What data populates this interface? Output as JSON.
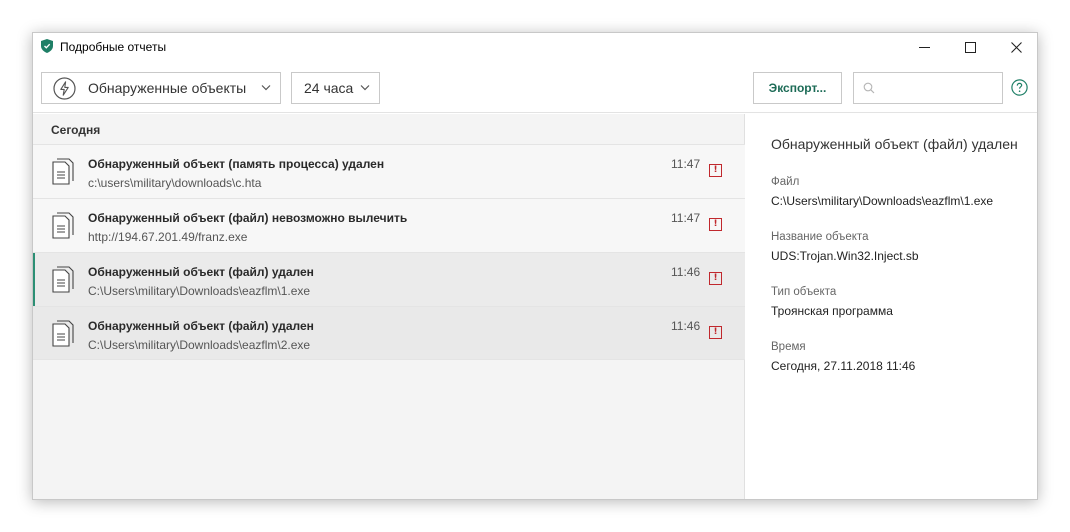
{
  "window": {
    "title": "Подробные отчеты"
  },
  "toolbar": {
    "type_filter": "Обнаруженные объекты",
    "period_filter": "24 часа",
    "export_label": "Экспорт...",
    "search_placeholder": ""
  },
  "list": {
    "group_label": "Сегодня",
    "rows": [
      {
        "title": "Обнаруженный объект (память процесса) удален",
        "path": "c:\\users\\military\\downloads\\c.hta",
        "time": "11:47",
        "badge": "!"
      },
      {
        "title": "Обнаруженный объект (файл) невозможно вылечить",
        "path": "http://194.67.201.49/franz.exe",
        "time": "11:47",
        "badge": "!"
      },
      {
        "title": "Обнаруженный объект (файл) удален",
        "path": "C:\\Users\\military\\Downloads\\eazflm\\1.exe",
        "time": "11:46",
        "badge": "!"
      },
      {
        "title": "Обнаруженный объект (файл) удален",
        "path": "C:\\Users\\military\\Downloads\\eazflm\\2.exe",
        "time": "11:46",
        "badge": "!"
      }
    ]
  },
  "details": {
    "title": "Обнаруженный объект (файл) удален",
    "fields": [
      {
        "label": "Файл",
        "value": "C:\\Users\\military\\Downloads\\eazflm\\1.exe"
      },
      {
        "label": "Название объекта",
        "value": "UDS:Trojan.Win32.Inject.sb"
      },
      {
        "label": "Тип объекта",
        "value": "Троянская программа"
      },
      {
        "label": "Время",
        "value": "Сегодня, 27.11.2018 11:46"
      }
    ]
  },
  "icons": {
    "app": "kaspersky-shield-icon",
    "type_filter": "lightning-icon",
    "row": "document-icon",
    "warning": "warning-icon",
    "search": "search-icon",
    "help": "help-icon"
  },
  "colors": {
    "accent": "#1c6b56",
    "selection_bar": "#2c8f74",
    "warning": "#c0282d"
  }
}
